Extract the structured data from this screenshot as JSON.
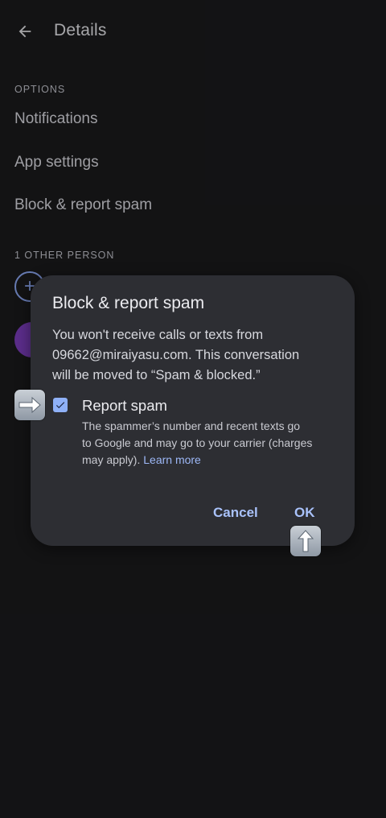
{
  "header": {
    "title": "Details",
    "back_icon": "arrow-left-icon"
  },
  "options": {
    "section_label": "OPTIONS",
    "items": [
      {
        "label": "Notifications"
      },
      {
        "label": "App settings"
      },
      {
        "label": "Block & report spam"
      }
    ]
  },
  "people": {
    "section_label": "1 OTHER PERSON",
    "add_icon": "plus-icon"
  },
  "dialog": {
    "title": "Block & report spam",
    "body_line1": "You won't receive calls or texts from",
    "body_line2": "09662@miraiyasu.com. This conversation",
    "body_line3": "will be moved to “Spam & blocked.”",
    "checkbox_checked": true,
    "checkbox_label": "Report spam",
    "checkbox_desc_line1": "The spammer’s number and recent texts go",
    "checkbox_desc_line2": "to Google and may go to your carrier (charges",
    "checkbox_desc_line3": "may apply). ",
    "learn_more": "Learn more",
    "cancel_label": "Cancel",
    "ok_label": "OK"
  },
  "annotations": {
    "right_arrow_icon": "right-arrow-icon",
    "up_arrow_icon": "up-arrow-icon"
  },
  "colors": {
    "background": "#1b1b1d",
    "dialog": "#2d2e33",
    "accent": "#a9c2fb",
    "avatar": "#7e3fbf"
  }
}
